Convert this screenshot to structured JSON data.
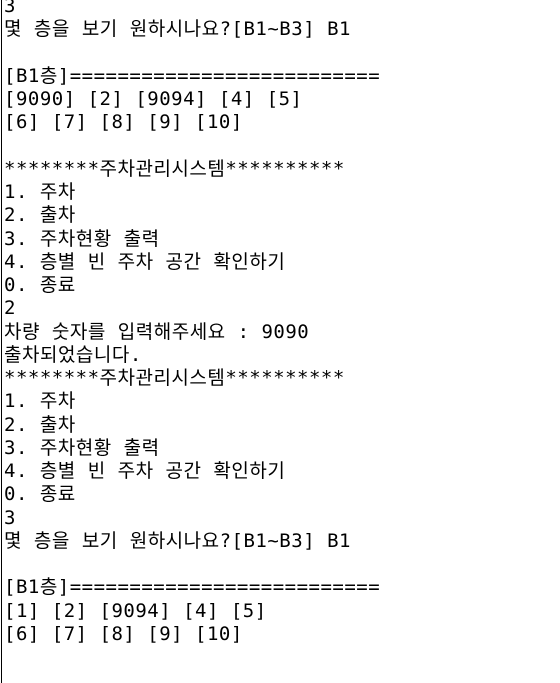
{
  "console": {
    "lines": [
      "3",
      "몇 층을 보기 원하시나요?[B1~B3] B1",
      "",
      "[B1층]==========================",
      "[9090] [2] [9094] [4] [5]",
      "[6] [7] [8] [9] [10]",
      "",
      "********주차관리시스템**********",
      "1. 주차",
      "2. 출차",
      "3. 주차현황 출력",
      "4. 층별 빈 주차 공간 확인하기",
      "0. 종료",
      "2",
      "차량 숫자를 입력해주세요 : 9090",
      "출차되었습니다.",
      "********주차관리시스템**********",
      "1. 주차",
      "2. 출차",
      "3. 주차현황 출력",
      "4. 층별 빈 주차 공간 확인하기",
      "0. 종료",
      "3",
      "몇 층을 보기 원하시나요?[B1~B3] B1",
      "",
      "[B1층]==========================",
      "[1] [2] [9094] [4] [5]",
      "[6] [7] [8] [9] [10]"
    ]
  }
}
